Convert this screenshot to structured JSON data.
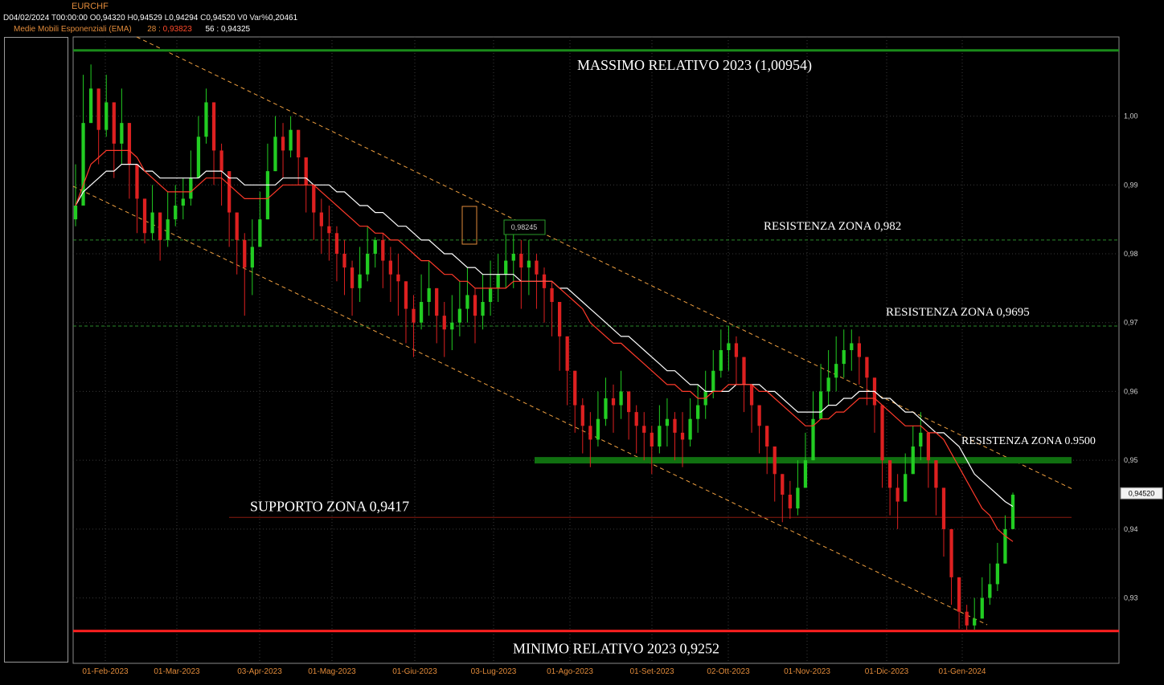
{
  "header": {
    "symbol": "EURCHF",
    "ohlc": [
      {
        "label": "D",
        "value": "04/02/2024"
      },
      {
        "label": "T",
        "value": "00:00:00"
      },
      {
        "label": "O",
        "value": "0,94320"
      },
      {
        "label": "H",
        "value": "0,94529"
      },
      {
        "label": "L",
        "value": "0,94294"
      },
      {
        "label": "C",
        "value": "0,94520"
      },
      {
        "label": "V",
        "value": "0"
      },
      {
        "label": "Var%",
        "value": "0,20461"
      }
    ],
    "ema_title": "Medie Mobili Esponenziali (EMA)",
    "ema28_label": "28 :",
    "ema28_value": "0,93823",
    "ema56_label": "56 :",
    "ema56_value": "0,94325"
  },
  "colors": {
    "background": "#000000",
    "bull": "#22cc22",
    "bear": "#dd2020",
    "ema28": "#ff3a2a",
    "ema56": "#ffffff",
    "channel": "#f0a040",
    "max_line": "#1a8a1a",
    "min_line": "#ff2020",
    "dashed_res": "#2a8a2a",
    "support": "#8a1a10",
    "zone_bar": "#107010",
    "axis_text": "#e08a3a"
  },
  "chart_data": {
    "type": "candlestick",
    "ylim": [
      0.9205,
      1.0115
    ],
    "y_ticks": [
      "0,93",
      "0,94",
      "0,95",
      "0,96",
      "0,97",
      "0,98",
      "0,99",
      "1,00"
    ],
    "x_ticks": [
      "01-Feb-2023",
      "01-Mar-2023",
      "03-Apr-2023",
      "01-Mag-2023",
      "01-Giu-2023",
      "03-Lug-2023",
      "01-Ago-2023",
      "01-Set-2023",
      "02-Ott-2023",
      "01-Nov-2023",
      "01-Dic-2023",
      "01-Gen-2024"
    ],
    "last_price_label": "0,94520",
    "last_price": 0.9452,
    "series_close": [
      0.987,
      0.999,
      1.004,
      0.998,
      1.002,
      0.996,
      0.999,
      0.993,
      0.988,
      0.983,
      0.986,
      0.982,
      0.985,
      0.987,
      0.988,
      0.991,
      0.997,
      1.002,
      0.995,
      0.992,
      0.986,
      0.982,
      0.978,
      0.981,
      0.985,
      0.992,
      0.997,
      0.995,
      0.998,
      0.994,
      0.99,
      0.986,
      0.984,
      0.983,
      0.98,
      0.978,
      0.975,
      0.977,
      0.98,
      0.982,
      0.979,
      0.977,
      0.976,
      0.972,
      0.97,
      0.973,
      0.975,
      0.971,
      0.969,
      0.97,
      0.972,
      0.974,
      0.971,
      0.973,
      0.975,
      0.977,
      0.979,
      0.98,
      0.978,
      0.979,
      0.977,
      0.975,
      0.973,
      0.968,
      0.963,
      0.958,
      0.955,
      0.953,
      0.956,
      0.959,
      0.958,
      0.96,
      0.957,
      0.955,
      0.954,
      0.952,
      0.955,
      0.956,
      0.954,
      0.953,
      0.956,
      0.958,
      0.96,
      0.963,
      0.966,
      0.967,
      0.965,
      0.961,
      0.958,
      0.955,
      0.952,
      0.948,
      0.945,
      0.943,
      0.946,
      0.95,
      0.956,
      0.96,
      0.962,
      0.964,
      0.966,
      0.967,
      0.965,
      0.962,
      0.958,
      0.95,
      0.946,
      0.944,
      0.948,
      0.952,
      0.954,
      0.95,
      0.946,
      0.94,
      0.933,
      0.928,
      0.926,
      0.927,
      0.93,
      0.932,
      0.935,
      0.94,
      0.945
    ],
    "series_high": [
      0.993,
      1.006,
      1.0075,
      1.004,
      1.006,
      1.001,
      1.004,
      0.997,
      0.992,
      0.987,
      0.99,
      0.985,
      0.989,
      0.99,
      0.991,
      0.995,
      1.0,
      1.004,
      0.999,
      0.996,
      0.99,
      0.985,
      0.983,
      0.985,
      0.989,
      0.996,
      1.0,
      0.999,
      1.0,
      0.998,
      0.994,
      0.989,
      0.988,
      0.987,
      0.984,
      0.982,
      0.979,
      0.981,
      0.984,
      0.9824,
      0.983,
      0.981,
      0.98,
      0.976,
      0.974,
      0.977,
      0.979,
      0.975,
      0.973,
      0.974,
      0.976,
      0.978,
      0.975,
      0.977,
      0.979,
      0.98,
      0.9828,
      0.9838,
      0.982,
      0.982,
      0.98,
      0.978,
      0.976,
      0.972,
      0.967,
      0.962,
      0.959,
      0.957,
      0.96,
      0.962,
      0.961,
      0.963,
      0.96,
      0.958,
      0.957,
      0.955,
      0.958,
      0.959,
      0.957,
      0.957,
      0.959,
      0.961,
      0.963,
      0.966,
      0.969,
      0.9695,
      0.968,
      0.964,
      0.961,
      0.958,
      0.955,
      0.951,
      0.948,
      0.947,
      0.95,
      0.954,
      0.96,
      0.964,
      0.966,
      0.968,
      0.969,
      0.969,
      0.968,
      0.965,
      0.962,
      0.954,
      0.95,
      0.948,
      0.951,
      0.955,
      0.957,
      0.953,
      0.949,
      0.943,
      0.936,
      0.931,
      0.929,
      0.93,
      0.933,
      0.935,
      0.938,
      0.942,
      0.9453
    ],
    "series_low": [
      0.984,
      0.994,
      0.999,
      0.993,
      0.997,
      0.991,
      0.993,
      0.988,
      0.983,
      0.9815,
      0.982,
      0.979,
      0.981,
      0.984,
      0.985,
      0.987,
      0.993,
      0.996,
      0.99,
      0.987,
      0.981,
      0.977,
      0.971,
      0.974,
      0.981,
      0.988,
      0.993,
      0.991,
      0.994,
      0.99,
      0.986,
      0.982,
      0.98,
      0.979,
      0.976,
      0.974,
      0.971,
      0.973,
      0.976,
      0.978,
      0.975,
      0.973,
      0.971,
      0.967,
      0.965,
      0.969,
      0.971,
      0.967,
      0.965,
      0.966,
      0.968,
      0.97,
      0.967,
      0.969,
      0.971,
      0.973,
      0.975,
      0.975,
      0.972,
      0.974,
      0.972,
      0.97,
      0.968,
      0.963,
      0.958,
      0.954,
      0.951,
      0.949,
      0.952,
      0.955,
      0.954,
      0.956,
      0.953,
      0.951,
      0.95,
      0.948,
      0.951,
      0.952,
      0.95,
      0.949,
      0.952,
      0.954,
      0.956,
      0.959,
      0.962,
      0.963,
      0.961,
      0.957,
      0.954,
      0.951,
      0.948,
      0.944,
      0.941,
      0.9415,
      0.942,
      0.946,
      0.952,
      0.956,
      0.958,
      0.96,
      0.962,
      0.963,
      0.961,
      0.958,
      0.954,
      0.946,
      0.942,
      0.94,
      0.944,
      0.948,
      0.95,
      0.946,
      0.942,
      0.936,
      0.929,
      0.9255,
      0.9252,
      0.9254,
      0.927,
      0.929,
      0.931,
      0.936,
      0.9429
    ],
    "ema28": [
      0.987,
      0.99,
      0.993,
      0.994,
      0.995,
      0.995,
      0.995,
      0.995,
      0.994,
      0.992,
      0.991,
      0.99,
      0.989,
      0.989,
      0.989,
      0.989,
      0.99,
      0.991,
      0.991,
      0.991,
      0.99,
      0.989,
      0.988,
      0.988,
      0.988,
      0.988,
      0.989,
      0.99,
      0.99,
      0.99,
      0.99,
      0.99,
      0.989,
      0.988,
      0.987,
      0.986,
      0.985,
      0.984,
      0.984,
      0.983,
      0.983,
      0.982,
      0.982,
      0.981,
      0.98,
      0.979,
      0.979,
      0.978,
      0.977,
      0.977,
      0.976,
      0.976,
      0.975,
      0.975,
      0.975,
      0.975,
      0.975,
      0.976,
      0.976,
      0.976,
      0.976,
      0.976,
      0.976,
      0.975,
      0.974,
      0.973,
      0.972,
      0.97,
      0.969,
      0.968,
      0.967,
      0.967,
      0.966,
      0.965,
      0.964,
      0.963,
      0.962,
      0.961,
      0.961,
      0.96,
      0.96,
      0.959,
      0.959,
      0.96,
      0.96,
      0.961,
      0.961,
      0.961,
      0.961,
      0.96,
      0.96,
      0.959,
      0.958,
      0.957,
      0.956,
      0.955,
      0.955,
      0.956,
      0.956,
      0.957,
      0.957,
      0.958,
      0.959,
      0.959,
      0.959,
      0.958,
      0.957,
      0.956,
      0.955,
      0.955,
      0.955,
      0.954,
      0.954,
      0.953,
      0.951,
      0.949,
      0.947,
      0.945,
      0.943,
      0.942,
      0.94,
      0.939,
      0.9382
    ],
    "ema56": [
      0.987,
      0.989,
      0.99,
      0.991,
      0.992,
      0.992,
      0.993,
      0.993,
      0.993,
      0.992,
      0.992,
      0.991,
      0.991,
      0.991,
      0.991,
      0.991,
      0.991,
      0.992,
      0.992,
      0.992,
      0.991,
      0.991,
      0.99,
      0.99,
      0.99,
      0.99,
      0.99,
      0.991,
      0.991,
      0.991,
      0.991,
      0.99,
      0.99,
      0.99,
      0.989,
      0.989,
      0.988,
      0.987,
      0.987,
      0.986,
      0.986,
      0.985,
      0.984,
      0.984,
      0.983,
      0.982,
      0.982,
      0.981,
      0.98,
      0.98,
      0.979,
      0.978,
      0.978,
      0.977,
      0.977,
      0.977,
      0.977,
      0.977,
      0.976,
      0.976,
      0.976,
      0.976,
      0.976,
      0.975,
      0.975,
      0.974,
      0.973,
      0.972,
      0.971,
      0.97,
      0.969,
      0.968,
      0.968,
      0.967,
      0.966,
      0.965,
      0.964,
      0.963,
      0.963,
      0.962,
      0.961,
      0.961,
      0.96,
      0.96,
      0.96,
      0.96,
      0.961,
      0.961,
      0.961,
      0.961,
      0.96,
      0.96,
      0.959,
      0.958,
      0.957,
      0.957,
      0.957,
      0.957,
      0.958,
      0.958,
      0.959,
      0.959,
      0.96,
      0.96,
      0.96,
      0.959,
      0.959,
      0.958,
      0.957,
      0.957,
      0.956,
      0.955,
      0.954,
      0.954,
      0.953,
      0.952,
      0.95,
      0.948,
      0.947,
      0.946,
      0.945,
      0.944,
      0.9433
    ],
    "levels": [
      {
        "label": "MASSIMO RELATIVO 2023 (1,00954)",
        "value": 1.00954,
        "style": "max"
      },
      {
        "label": "RESISTENZA ZONA 0,982",
        "value": 0.982,
        "style": "dashed"
      },
      {
        "label": "RESISTENZA ZONA 0,9695",
        "value": 0.9695,
        "style": "dashed"
      },
      {
        "label": "RESISTENZA ZONA  0.9500",
        "value": 0.95,
        "style": "zone"
      },
      {
        "label": "SUPPORTO ZONA 0,9417",
        "value": 0.9417,
        "style": "support"
      },
      {
        "label": "MINIMO RELATIVO 2023 0,9252",
        "value": 0.9252,
        "style": "min"
      }
    ],
    "callout_label": "0,98245",
    "callout_value": 0.98245
  }
}
